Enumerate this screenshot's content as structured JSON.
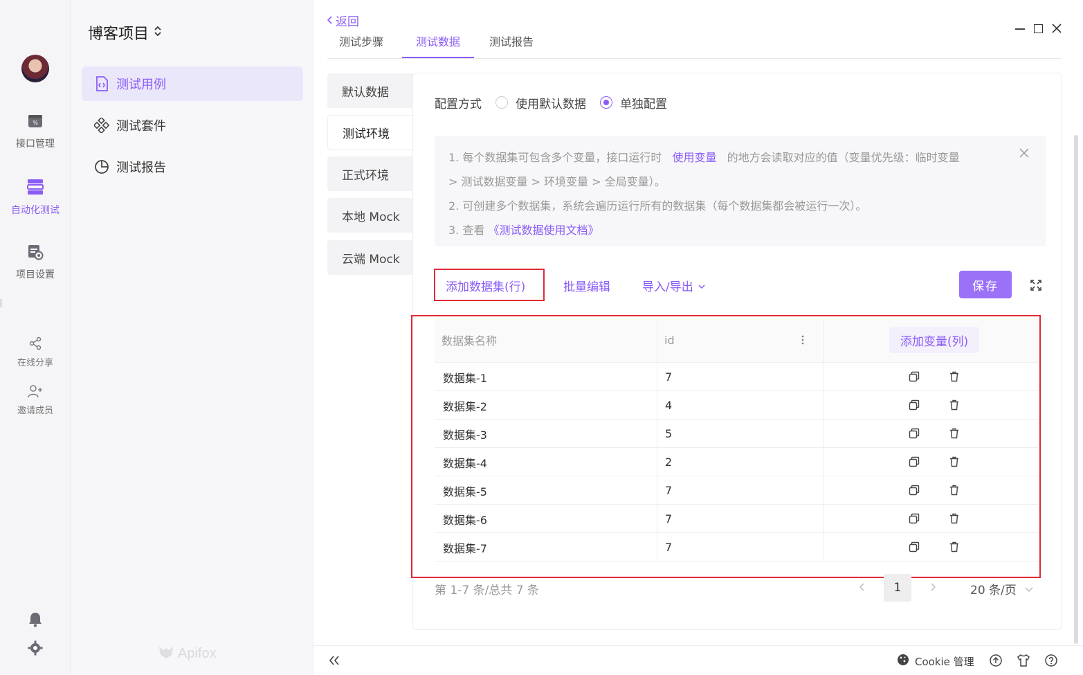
{
  "rail": {
    "items": [
      {
        "label": "接口管理",
        "icon": "api-icon"
      },
      {
        "label": "自动化测试",
        "icon": "automation-icon"
      },
      {
        "label": "项目设置",
        "icon": "settings-file-icon"
      },
      {
        "label": "在线分享",
        "icon": "share-icon"
      },
      {
        "label": "邀请成员",
        "icon": "invite-icon"
      }
    ]
  },
  "sidebar": {
    "project_title": "博客项目",
    "items": [
      {
        "label": "测试用例"
      },
      {
        "label": "测试套件"
      },
      {
        "label": "测试报告"
      }
    ],
    "brand": "Apifox"
  },
  "header": {
    "back": "返回",
    "tabs": [
      {
        "label": "测试步骤"
      },
      {
        "label": "测试数据"
      },
      {
        "label": "测试报告"
      }
    ]
  },
  "env_list": {
    "items": [
      {
        "label": "默认数据"
      },
      {
        "label": "测试环境"
      },
      {
        "label": "正式环境"
      },
      {
        "label": "本地 Mock"
      },
      {
        "label": "云端 Mock"
      }
    ]
  },
  "config": {
    "label": "配置方式",
    "option_default": "使用默认数据",
    "option_custom": "单独配置"
  },
  "notice": {
    "line1_a": "1. 每个数据集可包含多个变量，接口运行时",
    "line1_link": "使用变量",
    "line1_b": "的地方会读取对应的值（变量优先级：临时变量",
    "line2": "> 测试数据变量 > 环境变量 > 全局变量）。",
    "line3": "2. 可创建多个数据集，系统会遍历运行所有的数据集（每个数据集都会被运行一次）。",
    "line4_a": "3. 查看",
    "line4_link": "《测试数据使用文档》"
  },
  "toolbar": {
    "add_dataset": "添加数据集(行)",
    "batch_edit": "批量编辑",
    "import_export": "导入/导出",
    "save": "保存"
  },
  "table": {
    "col_name": "数据集名称",
    "col_id": "id",
    "add_variable": "添加变量(列)",
    "rows": [
      {
        "name": "数据集-1",
        "id": "7"
      },
      {
        "name": "数据集-2",
        "id": "4"
      },
      {
        "name": "数据集-3",
        "id": "5"
      },
      {
        "name": "数据集-4",
        "id": "2"
      },
      {
        "name": "数据集-5",
        "id": "7"
      },
      {
        "name": "数据集-6",
        "id": "7"
      },
      {
        "name": "数据集-7",
        "id": "7"
      }
    ]
  },
  "pagination": {
    "summary": "第 1-7 条/总共 7 条",
    "current_page": "1",
    "page_size": "20 条/页"
  },
  "footer": {
    "cookie": "Cookie 管理"
  },
  "colors": {
    "accent": "#8a5cf6",
    "highlight_red": "#e02a36"
  }
}
